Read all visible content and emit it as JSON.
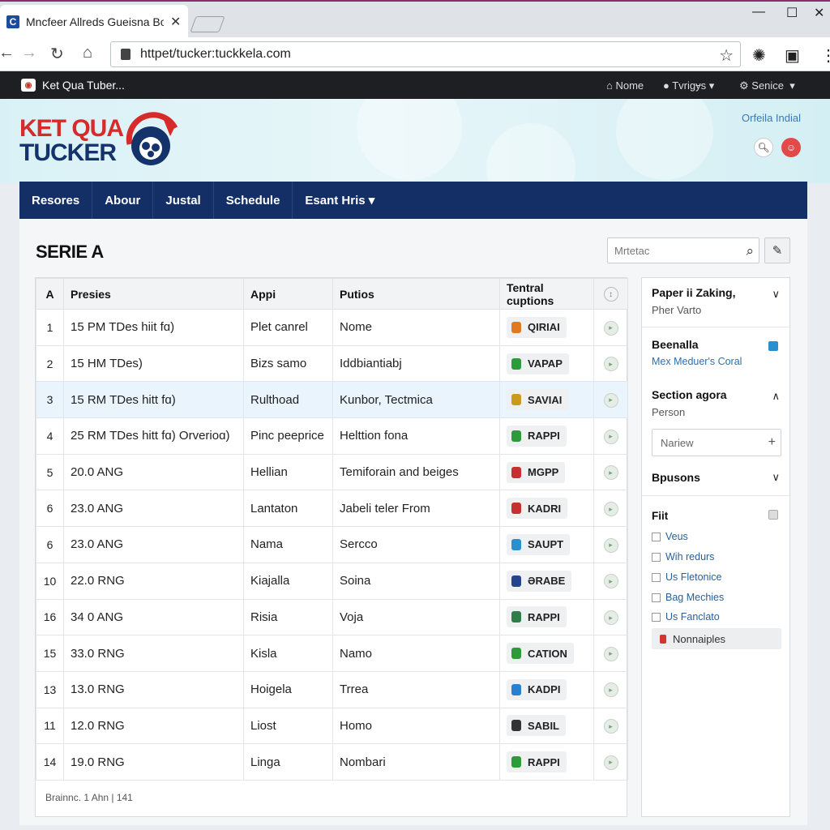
{
  "browser": {
    "tab_title": "Mncfeer Allreds Gueisna Bort",
    "favicon_letter": "C",
    "url": "httpet/tucker:tuckkela.com"
  },
  "site_strip": {
    "title": "Ket Qua Tuber...",
    "links": [
      "Nome",
      "Tvrigɏs",
      "Senice"
    ]
  },
  "banner": {
    "logo_line1": "KET QUA",
    "logo_line2": "TUCKER",
    "link": "Orfeila Indial"
  },
  "nav": {
    "items": [
      "Resores",
      "Abour",
      "Justal",
      "Schedule",
      "Esant Hris"
    ]
  },
  "page": {
    "title": "SERIE A",
    "search_placeholder": "Mrtetac"
  },
  "table": {
    "headers": [
      "A",
      "Presies",
      "Appi",
      "Putios",
      "Tentral cuptions"
    ],
    "rows": [
      {
        "num": "1",
        "time": "15 PM TDes hiit fɑ)",
        "appi": "Plet canrel",
        "putios": "Nome",
        "badge": "QIRIAI",
        "color": "#e07a1f"
      },
      {
        "num": "2",
        "time": "15 HM TDes)",
        "appi": "Bizs samo",
        "putios": "Iddbiantiabj",
        "badge": "VAPAP",
        "color": "#2e9b3a"
      },
      {
        "num": "3",
        "time": "15 RM TDes hitt fɑ)",
        "appi": "Rulthoad",
        "putios": "Kunbor, Tectmica",
        "badge": "SAVIAI",
        "color": "#c99b1c"
      },
      {
        "num": "4",
        "time": "25 RM TDes hitt fɑ) Orverioɑ)",
        "appi": "Pinc peeprice",
        "putios": "Helttion fona",
        "badge": "RAPPI",
        "color": "#2e9b3a"
      },
      {
        "num": "5",
        "time": "20.0 ANG",
        "appi": "Hellian",
        "putios": "Temiforain and beiges",
        "badge": "MGPP",
        "color": "#c73030"
      },
      {
        "num": "6",
        "time": "23.0 ANG",
        "appi": "Lantaton",
        "putios": "Jabeli teler From",
        "badge": "KADRI",
        "color": "#c73030"
      },
      {
        "num": "6",
        "time": "23.0 ANG",
        "appi": "Nama",
        "putios": "Sercco",
        "badge": "SAUPT",
        "color": "#2a8fcf"
      },
      {
        "num": "10",
        "time": "22.0 RNG",
        "appi": "Kiajalla",
        "putios": "Soina",
        "badge": "ƏRABE",
        "color": "#23458c"
      },
      {
        "num": "16",
        "time": "34 0 ANG",
        "appi": "Risia",
        "putios": "Voja",
        "badge": "RAPPI",
        "color": "#2e7d4a"
      },
      {
        "num": "15",
        "time": "33.0 RNG",
        "appi": "Kisla",
        "putios": "Namo",
        "badge": "CATION",
        "color": "#2e9b3a"
      },
      {
        "num": "13",
        "time": "13.0 RNG",
        "appi": "Hoigela",
        "putios": "Trrea",
        "badge": "KADPI",
        "color": "#2a7fcf"
      },
      {
        "num": "11",
        "time": "12.0 RNG",
        "appi": "Liost",
        "putios": "Homo",
        "badge": "SABIL",
        "color": "#333333"
      },
      {
        "num": "14",
        "time": "19.0 RNG",
        "appi": "Linga",
        "putios": "Nombari",
        "badge": "RAPPI",
        "color": "#2e9b3a"
      }
    ],
    "footer": "Brainnc. 1 Ahn | 141"
  },
  "sidebar": {
    "sec1_title": "Paper ii Zaking,",
    "sec1_sub": "Pher Varto",
    "sec2_title": "Beenalla",
    "sec2_link": "Mex Meduer's Coral",
    "sec3_title": "Section agora",
    "sec3_sub": "Person",
    "input_placeholder": "Nariew",
    "sec4_title": "Bpusons",
    "filter_title": "Fiit",
    "filters": [
      "Veus",
      "Wih redurs",
      "Us Fletonice",
      "Bag Mechies",
      "Us Fanclato"
    ],
    "nonn": "Nonnaiples"
  },
  "colors": {
    "nav_bg": "#132f65",
    "strip_bg": "#1e1f22",
    "logo_red": "#d72b2b",
    "logo_navy": "#15336b",
    "highlight_row": "#eaf4fd"
  }
}
